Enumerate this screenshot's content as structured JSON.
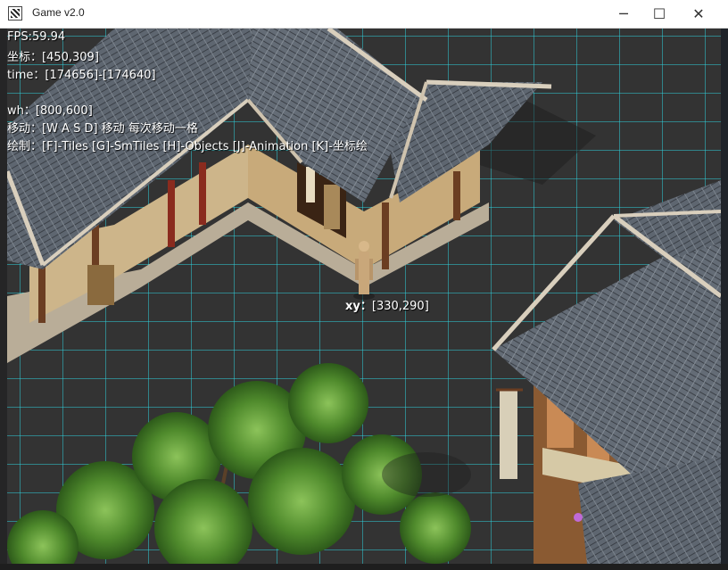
{
  "window": {
    "title": "Game v2.0",
    "minimize_glyph": "─",
    "maximize_glyph": "☐",
    "close_glyph": "✕"
  },
  "hud": {
    "fps": "FPS:59.94",
    "coord": "坐标：[450,309]",
    "time": "time：[174656]-[174640]",
    "wh": "wh：[800,600]",
    "move": "移动：[W A S D] 移动 每次移动一格",
    "draw": "绘制：[F]-Tiles [G]-SmTiles [H]-Objects [J]-Animation [K]-坐标绘"
  },
  "character": {
    "xy_prefix": "xy：",
    "xy_value": "[330,290]"
  },
  "colors": {
    "grid": "#2fd6e0",
    "ground": "#333333",
    "roof": "#5e6670",
    "wall": "#cdb58a",
    "wood": "#6b3e22",
    "tree": "#4f8a2c"
  },
  "icons": {
    "app": "game-app-icon",
    "character": "warrior-sprite"
  }
}
